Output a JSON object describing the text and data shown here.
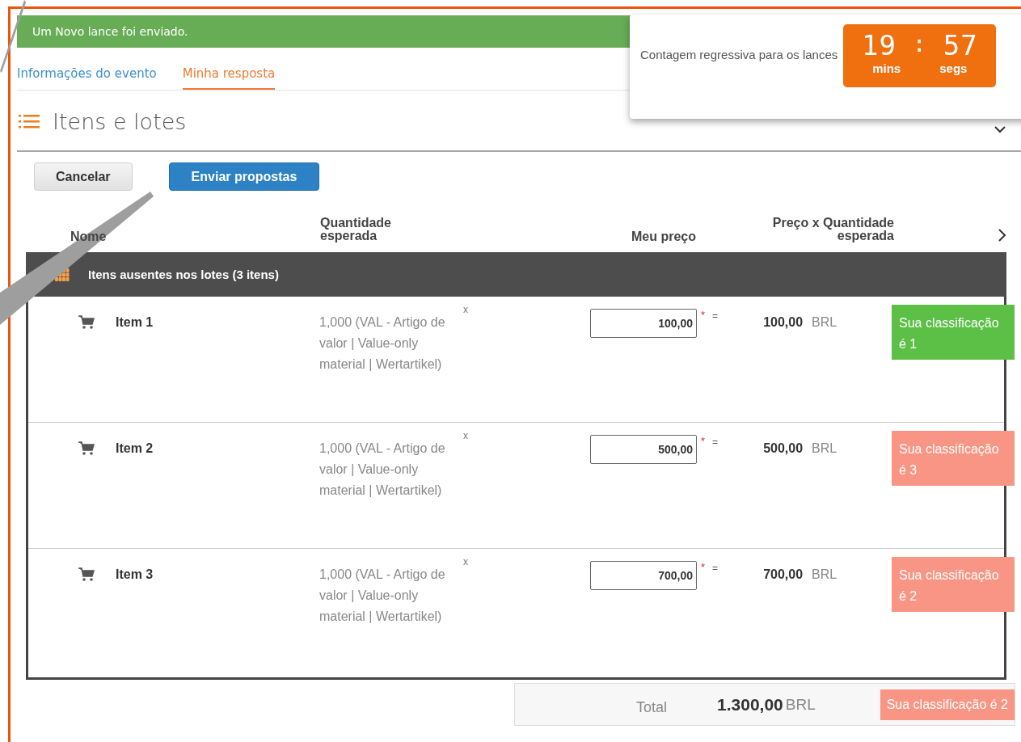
{
  "notification": {
    "text": "Um Novo lance foi enviado."
  },
  "tabs": [
    {
      "label": "Informações do evento",
      "selected": false
    },
    {
      "label": "Minha resposta",
      "selected": true
    }
  ],
  "countdown": {
    "label": "Contagem regressiva para os lances",
    "minutes": "19",
    "separator": ":",
    "seconds": "57",
    "minutes_label": "mins",
    "seconds_label": "segs"
  },
  "section": {
    "title": "Itens e lotes",
    "expanded": true
  },
  "buttons": [
    {
      "label": "Cancelar",
      "kind": "secondary"
    },
    {
      "label": "Enviar propostas",
      "kind": "primary"
    }
  ],
  "table": {
    "columns": [
      "Nome",
      "Quantidade esperada",
      "Meu preço",
      "Preço x Quantidade esperada"
    ],
    "group": {
      "title": "Itens ausentes nos lotes (3 itens)"
    },
    "rows": [
      {
        "name": "Item 1",
        "quantity": "1,000 (VAL - Artigo de valor | Value-only material | Wertartikel)",
        "times": "x",
        "price": "100,00",
        "required": "*",
        "equals": "=",
        "total": "100,00",
        "currency": "BRL",
        "rank": "Sua classificação é 1",
        "color": "#5cbf46"
      },
      {
        "name": "Item 2",
        "quantity": "1,000 (VAL - Artigo de valor | Value-only material | Wertartikel)",
        "times": "x",
        "price": "500,00",
        "required": "*",
        "equals": "=",
        "total": "500,00",
        "currency": "BRL",
        "rank": "Sua classificação é 3",
        "color": "#f99584"
      },
      {
        "name": "Item 3",
        "quantity": "1,000 (VAL - Artigo de valor | Value-only material | Wertartikel)",
        "times": "x",
        "price": "700,00",
        "required": "*",
        "equals": "=",
        "total": "700,00",
        "currency": "BRL",
        "rank": "Sua classificação é 2",
        "color": "#f99584"
      }
    ],
    "total": {
      "label": "Total",
      "value": "1.300,00",
      "currency": "BRL",
      "rank": "Sua classificação é 2",
      "color": "#f99584"
    }
  }
}
